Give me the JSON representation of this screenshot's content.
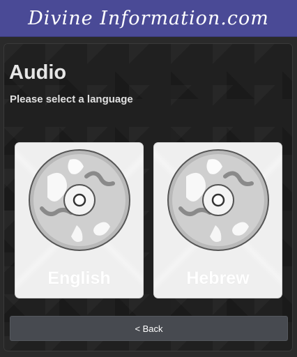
{
  "header": {
    "logo_text": "Divine Information.com"
  },
  "page": {
    "title": "Audio",
    "subtitle": "Please select a language"
  },
  "languages": [
    {
      "label": "English",
      "icon": "cd-disc-icon"
    },
    {
      "label": "Hebrew",
      "icon": "cd-disc-icon"
    }
  ],
  "footer": {
    "back_label": "< Back"
  },
  "colors": {
    "header_bg": "#4a4a96",
    "panel_bg": "#202020",
    "card_bg": "#efefef",
    "button_bg": "#474a50"
  }
}
